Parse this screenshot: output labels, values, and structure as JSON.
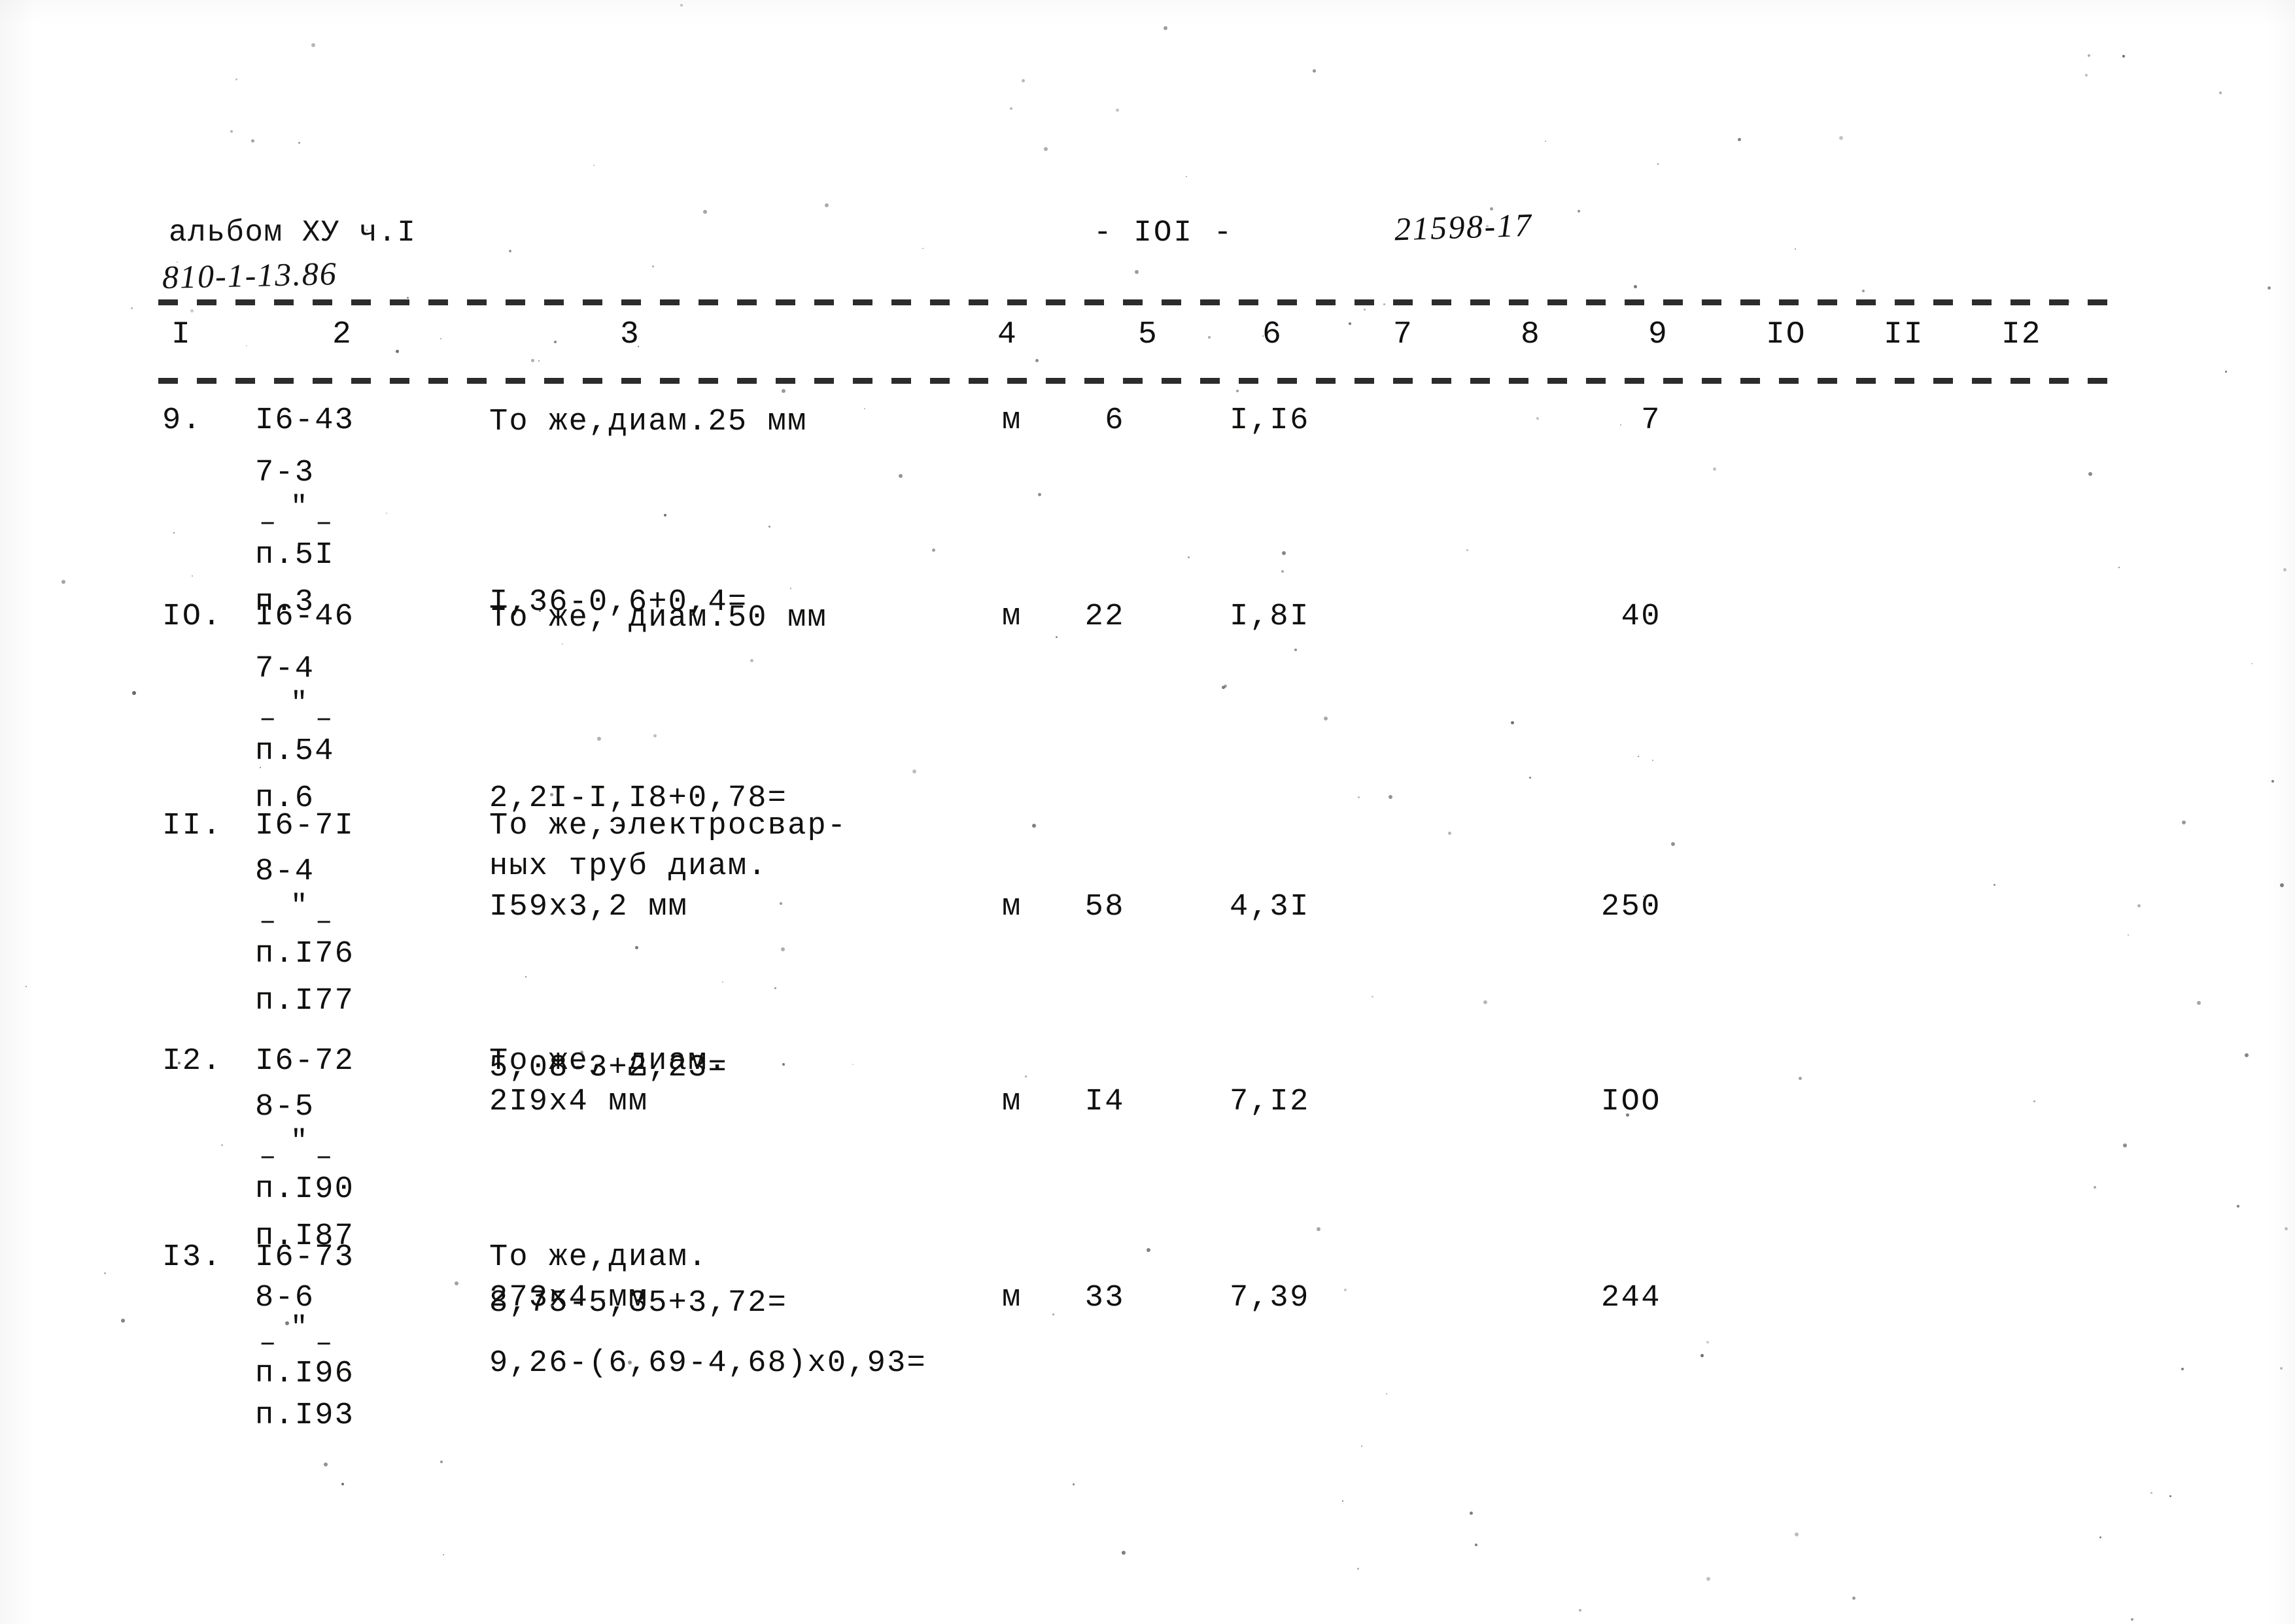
{
  "header": {
    "album_label": "альбом ХУ ч.I",
    "album_code": "810-1-13.86",
    "page_number": "- IOI -",
    "doc_number": "21598-17"
  },
  "table": {
    "column_numbers": [
      "I",
      "2",
      "3",
      "4",
      "5",
      "6",
      "7",
      "8",
      "9",
      "IO",
      "II",
      "I2"
    ],
    "rows": [
      {
        "item_no": "9.",
        "code_lines": [
          "I6-43",
          "7-3",
          "-\"-",
          "п.5I",
          "п.3"
        ],
        "description_lines": [
          "То же,диам.25 мм"
        ],
        "formula": "I,36-0,6+0,4=",
        "unit": "м",
        "qty": "6",
        "price": "I,I6",
        "total": "7"
      },
      {
        "item_no": "IO.",
        "code_lines": [
          "I6-46",
          "7-4",
          "-\"-",
          "п.54",
          "п.6"
        ],
        "description_lines": [
          "То же, диам.50 мм"
        ],
        "formula": "2,2I-I,I8+0,78=",
        "unit": "м",
        "qty": "22",
        "price": "I,8I",
        "total": "40"
      },
      {
        "item_no": "II.",
        "code_lines": [
          "I6-7I",
          "8-4",
          "-\"-",
          "п.I76",
          "п.I77"
        ],
        "description_lines": [
          "То же,электросвар-",
          "ных труб диам.",
          "I59х3,2 мм"
        ],
        "formula": "5,08-3+2,23=",
        "unit": "м",
        "qty": "58",
        "price": "4,3I",
        "total": "250"
      },
      {
        "item_no": "I2.",
        "code_lines": [
          "I6-72",
          "8-5",
          "-\"-",
          "п.I90",
          "п.I87"
        ],
        "description_lines": [
          "То же, диам.",
          "2I9х4 мм"
        ],
        "formula": "8,75-5,35+3,72=",
        "unit": "м",
        "qty": "I4",
        "price": "7,I2",
        "total": "IOO"
      },
      {
        "item_no": "I3.",
        "code_lines": [
          "I6-73",
          "8-6",
          "-\"-",
          "п.I96",
          "п.I93"
        ],
        "description_lines": [
          "То же,диам.",
          "273х4 мм"
        ],
        "formula": "9,26-(6,69-4,68)х0,93=",
        "unit": "м",
        "qty": "33",
        "price": "7,39",
        "total": "244"
      }
    ]
  }
}
